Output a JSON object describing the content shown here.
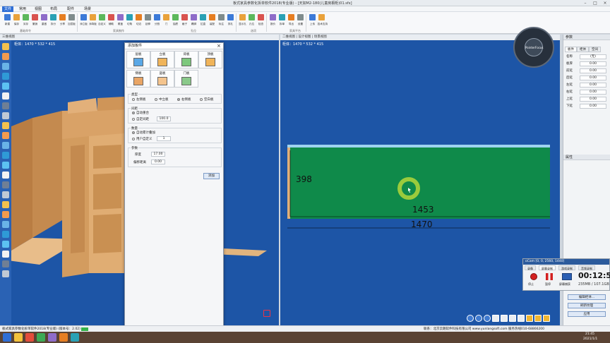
{
  "window": {
    "title": "板式家具参数化拆单软件2018(专业版) - [天如M2-180(儿童房橱柜)01.sfx]"
  },
  "menu": [
    "文件",
    "常用",
    "视图",
    "布局",
    "配件",
    "场景"
  ],
  "menu_active": "文件",
  "ribbon": {
    "buttons": [
      "新建",
      "保存",
      "另存",
      "撤销",
      "重做",
      "拆分",
      "分享",
      "加层板",
      "添立板",
      "添背板",
      "自定义",
      "辅助",
      "覆盖",
      "切角",
      "切边",
      "延伸",
      "分割",
      "门",
      "抽屉",
      "格子",
      "踢脚",
      "拉直",
      "装配",
      "标注",
      "排孔",
      "显示孔",
      "孔位",
      "检查",
      "报价",
      "拆单",
      "导出",
      "设置",
      "上传",
      "技术支持"
    ],
    "groups": [
      "基础命令",
      "家具制作",
      "孔位",
      "选项",
      "家具平台"
    ]
  },
  "left_view": {
    "header": "三维视图",
    "dims": "柜体：1470 * 532 * 415"
  },
  "right_view": {
    "header": "二维视图 | 设计视图 | 场景视图",
    "dims": "柜体：1470 * 532 * 415"
  },
  "dialog": {
    "title": "添加板件",
    "tabs": [
      "层板",
      "立板",
      "背板",
      "顶板",
      "侧板",
      "竖板",
      "门板"
    ],
    "section_type": "类型",
    "type_options": [
      "左侧板",
      "中立板",
      "右侧板",
      "空白板"
    ],
    "type_selected": 2,
    "section_gap": "间距",
    "gap_options": [
      "自动重合",
      "自定间距"
    ],
    "gap_value": "100.0",
    "section_count": "数量",
    "count_options": [
      "自动累计叠加",
      "用户自定义"
    ],
    "count_value": "1",
    "section_param": "参数",
    "thickness_label": "厚度",
    "thickness_value": "17.00",
    "offset_label": "偏移距离",
    "offset_value": "0.00",
    "add_button": "添加",
    "close_icon": "×"
  },
  "drawing": {
    "height_label": "398",
    "inner_width": "1453",
    "outer_width": "1470",
    "board_color": "#0f8a4a"
  },
  "panel": {
    "header": "参数",
    "tabs": [
      "板件",
      "柜体",
      "空间"
    ],
    "rows": [
      {
        "k": "名称",
        "v": "(无)"
      },
      {
        "k": "板厚",
        "v": "0.00"
      },
      {
        "k": "前延",
        "v": "0.00"
      },
      {
        "k": "后延",
        "v": "0.00"
      },
      {
        "k": "左延",
        "v": "0.00"
      },
      {
        "k": "右延",
        "v": "0.00"
      },
      {
        "k": "上延",
        "v": "0.00"
      },
      {
        "k": "下延",
        "v": "0.00"
      }
    ],
    "side_header": "属性",
    "side_buttons": [
      "编辑柜体...",
      "刷新纹理",
      "应用"
    ]
  },
  "ocam": {
    "title": "oCam [0, 0, 2560, 1440]",
    "tabs": [
      "录像",
      "屏幕录制",
      "游戏录制",
      "音频录制"
    ],
    "rec_label": "停止",
    "pause_label": "暂停",
    "screen_label": "屏幕捕获",
    "time": "00:12:51",
    "size": "235MB / 107.1GB"
  },
  "status": {
    "left": "板式家具参数化拆单软件2018(专业版) (版本号：2.02)",
    "right": "联系：北京云朗软件科技有限公司 www.yunlangsoft.com  服务热线010-68866200"
  },
  "nav_compass": {
    "center": "PointerFocus"
  },
  "taskbar": {
    "time": "21:45",
    "date": "2021/1/1"
  }
}
